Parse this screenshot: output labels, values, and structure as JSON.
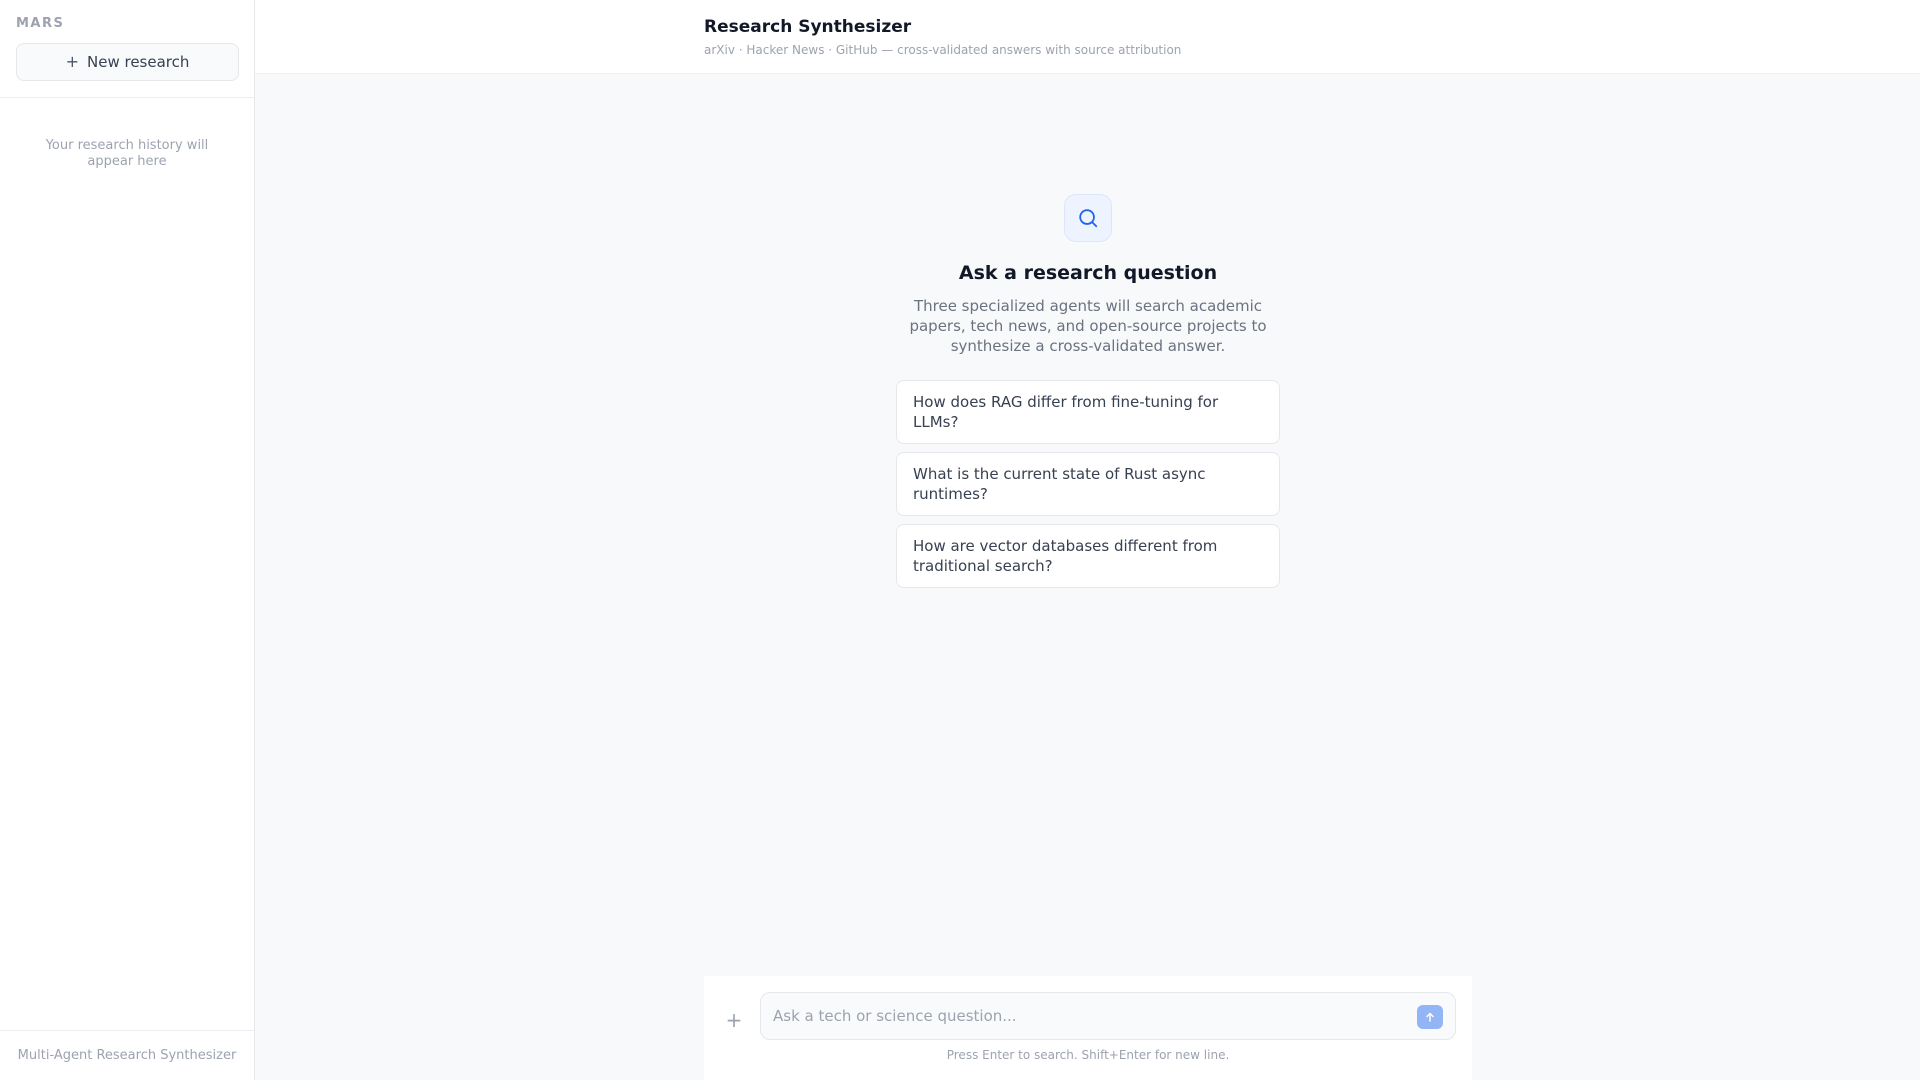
{
  "sidebar": {
    "brand": "MARS",
    "new_research_label": "New research",
    "history_empty": "Your research history will appear here",
    "footer": "Multi-Agent Research Synthesizer"
  },
  "header": {
    "title": "Research Synthesizer",
    "subtitle": "arXiv · Hacker News · GitHub — cross-validated answers with source attribution"
  },
  "hero": {
    "icon": "search-icon",
    "title": "Ask a research question",
    "description": "Three specialized agents will search academic papers, tech news, and open-source projects to synthesize a cross-validated answer."
  },
  "suggestions": [
    "How does RAG differ from fine-tuning for LLMs?",
    "What is the current state of Rust async runtimes?",
    "How are vector databases different from traditional search?"
  ],
  "composer": {
    "placeholder": "Ask a tech or science question...",
    "hint": "Press Enter to search. Shift+Enter for new line."
  },
  "colors": {
    "accent": "#2563eb",
    "send_button": "#93b4f5"
  }
}
